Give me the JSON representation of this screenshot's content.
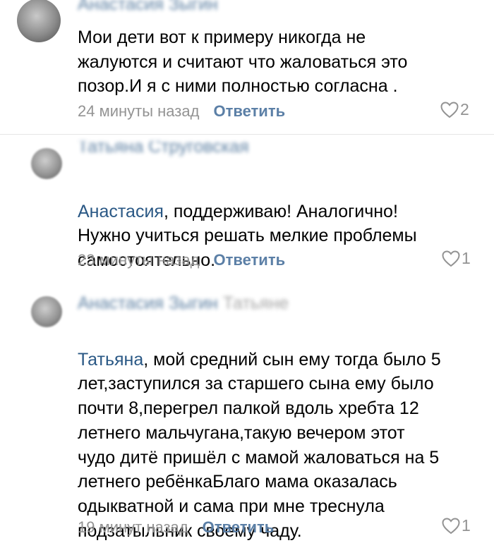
{
  "comments": [
    {
      "author": "Анастасия Зыгин",
      "reply_to": "",
      "mention": "",
      "text": "Мои дети вот к примеру никогда не\nжалуются и считают что жаловаться это\nпозор.И я с ними полностью согласна .",
      "time": "24 минуты назад",
      "reply_label": "Ответить",
      "likes": "2"
    },
    {
      "author": "Татьяна Струговская",
      "reply_to": "",
      "mention": "Анастасия",
      "text": ", поддерживаю! Аналогично!\nНужно учиться решать мелкие проблемы\nсамостоятельно.",
      "time": "23 минуты назад",
      "reply_label": "Ответить",
      "likes": "1"
    },
    {
      "author": "Анастасия Зыгин",
      "reply_to": "Татьяне",
      "mention": "Татьяна",
      "text": ", мой средний сын ему тогда было 5\nлет,заступился за старшего сына ему было\nпочти 8,перегрел палкой вдоль хребта 12\nлетнего мальчугана,такую вечером этот\nчудо дитё пришёл с мамой жаловаться на 5\nлетнего ребёнкаБлаго мама оказалась\nодыкватной и сама при мне треснула\nподзатыльник своему чаду.",
      "time": "19 минут назад",
      "reply_label": "Ответить",
      "likes": "1"
    }
  ],
  "colors": {
    "link": "#2a5885",
    "reply": "#5b7fa6",
    "meta": "#939393",
    "divider": "#e6e6e6"
  },
  "icons": {
    "like": "heart-outline-icon"
  }
}
